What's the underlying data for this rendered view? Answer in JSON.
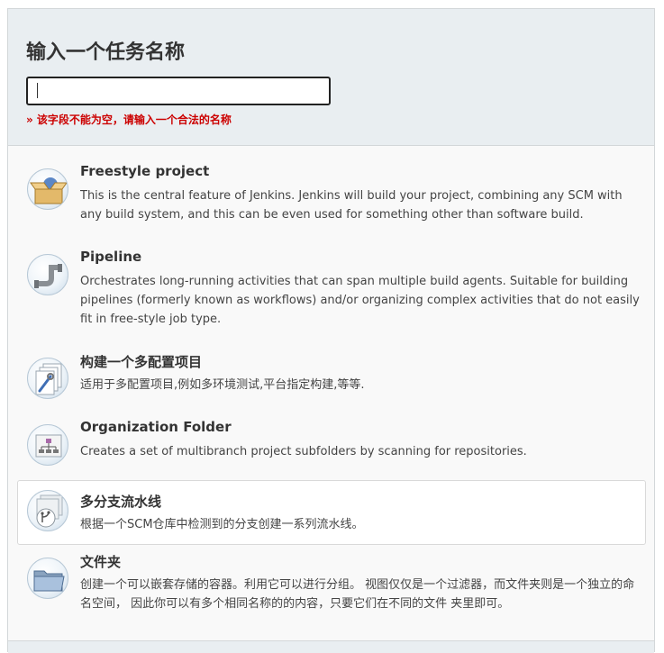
{
  "header": {
    "title": "输入一个任务名称",
    "name_input": {
      "value": "",
      "placeholder": ""
    },
    "error": "» 该字段不能为空，请输入一个合法的名称"
  },
  "items": [
    {
      "name": "Freestyle project",
      "icon": "freestyle-box-icon",
      "desc": "This is the central feature of Jenkins. Jenkins will build your project, combining any SCM with any build system, and this can be even used for something other than software build."
    },
    {
      "name": "Pipeline",
      "icon": "pipeline-pipe-icon",
      "desc": "Orchestrates long-running activities that can span multiple build agents. Suitable for building pipelines (formerly known as workflows) and/or organizing complex activities that do not easily fit in free-style job type."
    },
    {
      "name": "构建一个多配置项目",
      "icon": "multi-config-icon",
      "desc": "适用于多配置项目,例如多环境测试,平台指定构建,等等."
    },
    {
      "name": "Organization Folder",
      "icon": "organization-folder-icon",
      "desc": "Creates a set of multibranch project subfolders by scanning for repositories."
    },
    {
      "name": "多分支流水线",
      "icon": "multibranch-pipeline-icon",
      "desc": "根据一个SCM仓库中检测到的分支创建一系列流水线。"
    },
    {
      "name": "文件夹",
      "icon": "folder-icon",
      "desc": "创建一个可以嵌套存储的容器。利用它可以进行分组。 视图仅仅是一个过滤器，而文件夹则是一个独立的命名空间， 因此你可以有多个相同名称的的内容，只要它们在不同的文件 夹里即可。"
    }
  ],
  "selected_index": 4
}
